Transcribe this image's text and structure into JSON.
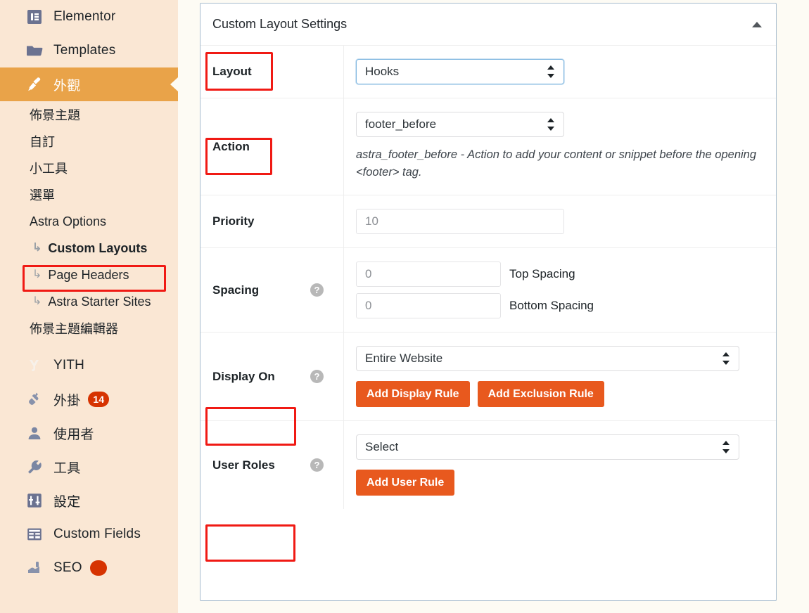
{
  "colors": {
    "sidebar_bg": "#fae7d4",
    "sidebar_active_bg": "#e9a349",
    "highlight_red": "#f01a14",
    "button_orange": "#e8591e",
    "badge_red": "#d63301",
    "page_bg": "#fdfbf4"
  },
  "sidebar": {
    "items": [
      {
        "label": "Elementor",
        "icon": "elementor-icon",
        "type": "top"
      },
      {
        "label": "Templates",
        "icon": "folder-icon",
        "type": "top"
      },
      {
        "label": "外觀",
        "icon": "paintbrush-icon",
        "type": "top",
        "active": true
      },
      {
        "label": "佈景主題",
        "type": "sub"
      },
      {
        "label": "自訂",
        "type": "sub"
      },
      {
        "label": "小工具",
        "type": "sub"
      },
      {
        "label": "選單",
        "type": "sub"
      },
      {
        "label": "Astra Options",
        "type": "sub"
      },
      {
        "label": "Custom Layouts",
        "type": "sub-nested",
        "highlighted": true
      },
      {
        "label": "Page Headers",
        "type": "sub-nested"
      },
      {
        "label": "Astra Starter Sites",
        "type": "sub-nested"
      },
      {
        "label": "佈景主題編輯器",
        "type": "sub"
      },
      {
        "label": "YITH",
        "icon": "yith-icon",
        "type": "top"
      },
      {
        "label": "外掛",
        "icon": "plug-icon",
        "type": "top",
        "badge": "14"
      },
      {
        "label": "使用者",
        "icon": "user-icon",
        "type": "top"
      },
      {
        "label": "工具",
        "icon": "wrench-icon",
        "type": "top"
      },
      {
        "label": "設定",
        "icon": "sliders-icon",
        "type": "top"
      },
      {
        "label": "Custom Fields",
        "icon": "fields-icon",
        "type": "top"
      },
      {
        "label": "SEO",
        "icon": "seo-icon",
        "type": "top",
        "badge": "",
        "partial": true
      }
    ]
  },
  "panel": {
    "title": "Custom Layout Settings",
    "collapse_icon": "triangle-up-icon",
    "rows": {
      "layout": {
        "label": "Layout",
        "select_value": "Hooks",
        "highlighted": true
      },
      "action": {
        "label": "Action",
        "select_value": "footer_before",
        "description": "astra_footer_before - Action to add your content or snippet before the opening <footer> tag.",
        "highlighted": true
      },
      "priority": {
        "label": "Priority",
        "input_value": "10"
      },
      "spacing": {
        "label": "Spacing",
        "help_icon": "question-mark-icon",
        "top_value": "0",
        "top_label": "Top Spacing",
        "bottom_value": "0",
        "bottom_label": "Bottom Spacing"
      },
      "display_on": {
        "label": "Display On",
        "help_icon": "question-mark-icon",
        "select_value": "Entire Website",
        "add_display_rule_label": "Add Display Rule",
        "add_exclusion_rule_label": "Add Exclusion Rule",
        "highlighted": true
      },
      "user_roles": {
        "label": "User Roles",
        "help_icon": "question-mark-icon",
        "select_value": "Select",
        "add_user_rule_label": "Add User Rule",
        "highlighted": true
      }
    }
  },
  "glyphs": {
    "help": "?",
    "sub_arrow": "↳"
  }
}
